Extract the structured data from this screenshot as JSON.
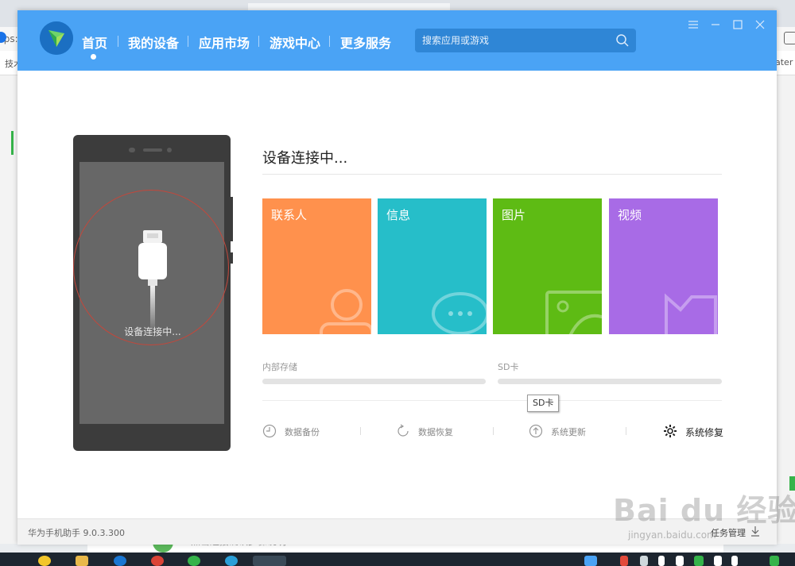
{
  "app": {
    "nav": [
      {
        "label": "首页",
        "active": true
      },
      {
        "label": "我的设备"
      },
      {
        "label": "应用市场"
      },
      {
        "label": "游戏中心"
      },
      {
        "label": "更多服务"
      }
    ],
    "search_placeholder": "搜索应用或游戏",
    "phone_status": "设备连接中...",
    "connecting_title": "设备连接中...",
    "tiles": [
      {
        "label": "联系人",
        "color": "#ff914d"
      },
      {
        "label": "信息",
        "color": "#26bec9"
      },
      {
        "label": "图片",
        "color": "#5ebb14"
      },
      {
        "label": "视频",
        "color": "#a86be6"
      }
    ],
    "storage": [
      {
        "label": "内部存储"
      },
      {
        "label": "SD卡"
      }
    ],
    "tooltip": "SD卡",
    "actions": [
      {
        "label": "数据备份",
        "icon": "backup-clock-icon"
      },
      {
        "label": "数据恢复",
        "icon": "restore-icon"
      },
      {
        "label": "系统更新",
        "icon": "update-arrow-icon"
      },
      {
        "label": "系统修复",
        "icon": "gear-icon"
      }
    ],
    "version": "华为手机助手 9.0.3.300",
    "task_manager": "任务管理"
  },
  "background": {
    "addr_fragment": "tps:/",
    "bookmark_fragment": "技术",
    "bookmark_fragment_right": "ater",
    "strip_text": "点击连接确认步骤说明"
  },
  "watermark": {
    "brand": "Bai du 经验",
    "url": "jingyan.baidu.com"
  },
  "colors": {
    "titlebar": "#4aa3f5",
    "accent_ring": "#c4473b"
  }
}
